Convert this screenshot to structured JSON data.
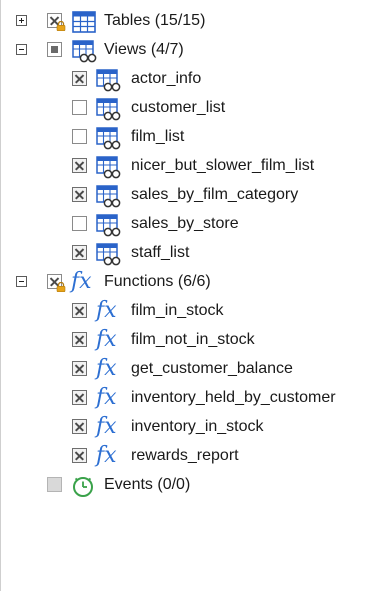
{
  "tree": {
    "tables": {
      "label": "Tables",
      "count": "(15/15)",
      "icon": "table-icon",
      "expanded": false
    },
    "views": {
      "label": "Views",
      "count": "(4/7)",
      "icon": "view-icon",
      "expanded": true,
      "items": [
        {
          "label": "actor_info",
          "checked": true
        },
        {
          "label": "customer_list",
          "checked": false
        },
        {
          "label": "film_list",
          "checked": false
        },
        {
          "label": "nicer_but_slower_film_list",
          "checked": true
        },
        {
          "label": "sales_by_film_category",
          "checked": true
        },
        {
          "label": "sales_by_store",
          "checked": false
        },
        {
          "label": "staff_list",
          "checked": true
        }
      ]
    },
    "functions": {
      "label": "Functions",
      "count": "(6/6)",
      "icon": "function-icon",
      "glyph": "fx",
      "expanded": true,
      "items": [
        {
          "label": "film_in_stock",
          "checked": true
        },
        {
          "label": "film_not_in_stock",
          "checked": true
        },
        {
          "label": "get_customer_balance",
          "checked": true
        },
        {
          "label": "inventory_held_by_customer",
          "checked": true
        },
        {
          "label": "inventory_in_stock",
          "checked": true
        },
        {
          "label": "rewards_report",
          "checked": true
        }
      ]
    },
    "events": {
      "label": "Events",
      "count": "(0/0)",
      "icon": "clock-icon"
    }
  },
  "colors": {
    "icon_blue": "#2f6fd6",
    "grid_blue": "#2a63c9",
    "function_blue": "#2d6fd2",
    "clock_green": "#3aa24a",
    "lock_orange": "#e8a317"
  }
}
